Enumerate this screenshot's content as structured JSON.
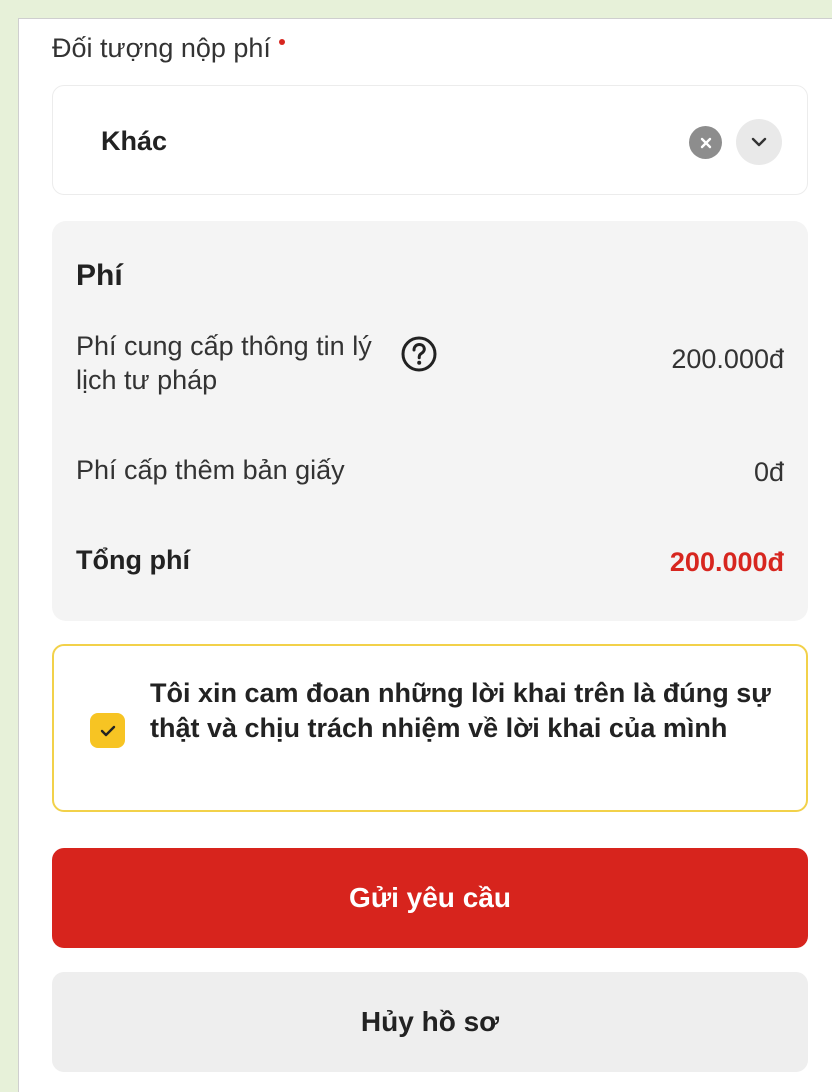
{
  "field": {
    "label": "Đối tượng nộp phí",
    "selected": "Khác",
    "clear_icon": "clear-circle-icon",
    "dropdown_icon": "chevron-down-icon"
  },
  "fees": {
    "title": "Phí",
    "items": [
      {
        "label": "Phí cung cấp thông tin lý lịch tư pháp",
        "value": "200.000đ",
        "icon": "help-circle-icon"
      },
      {
        "label": "Phí cấp thêm bản giấy",
        "value": "0đ"
      }
    ],
    "total_label": "Tổng phí",
    "total_value": "200.000đ"
  },
  "commitment": {
    "checked": true,
    "text": "Tôi xin cam đoan những lời khai trên là đúng sự thật và chịu trách nhiệm về lời khai của mình"
  },
  "actions": {
    "submit_label": "Gửi yêu cầu",
    "cancel_label": "Hủy hồ sơ"
  },
  "colors": {
    "accent_red": "#d7241d",
    "checkbox_yellow": "#f7c423",
    "commit_border": "#f2d14a",
    "page_margin": "#e7f1d9"
  }
}
